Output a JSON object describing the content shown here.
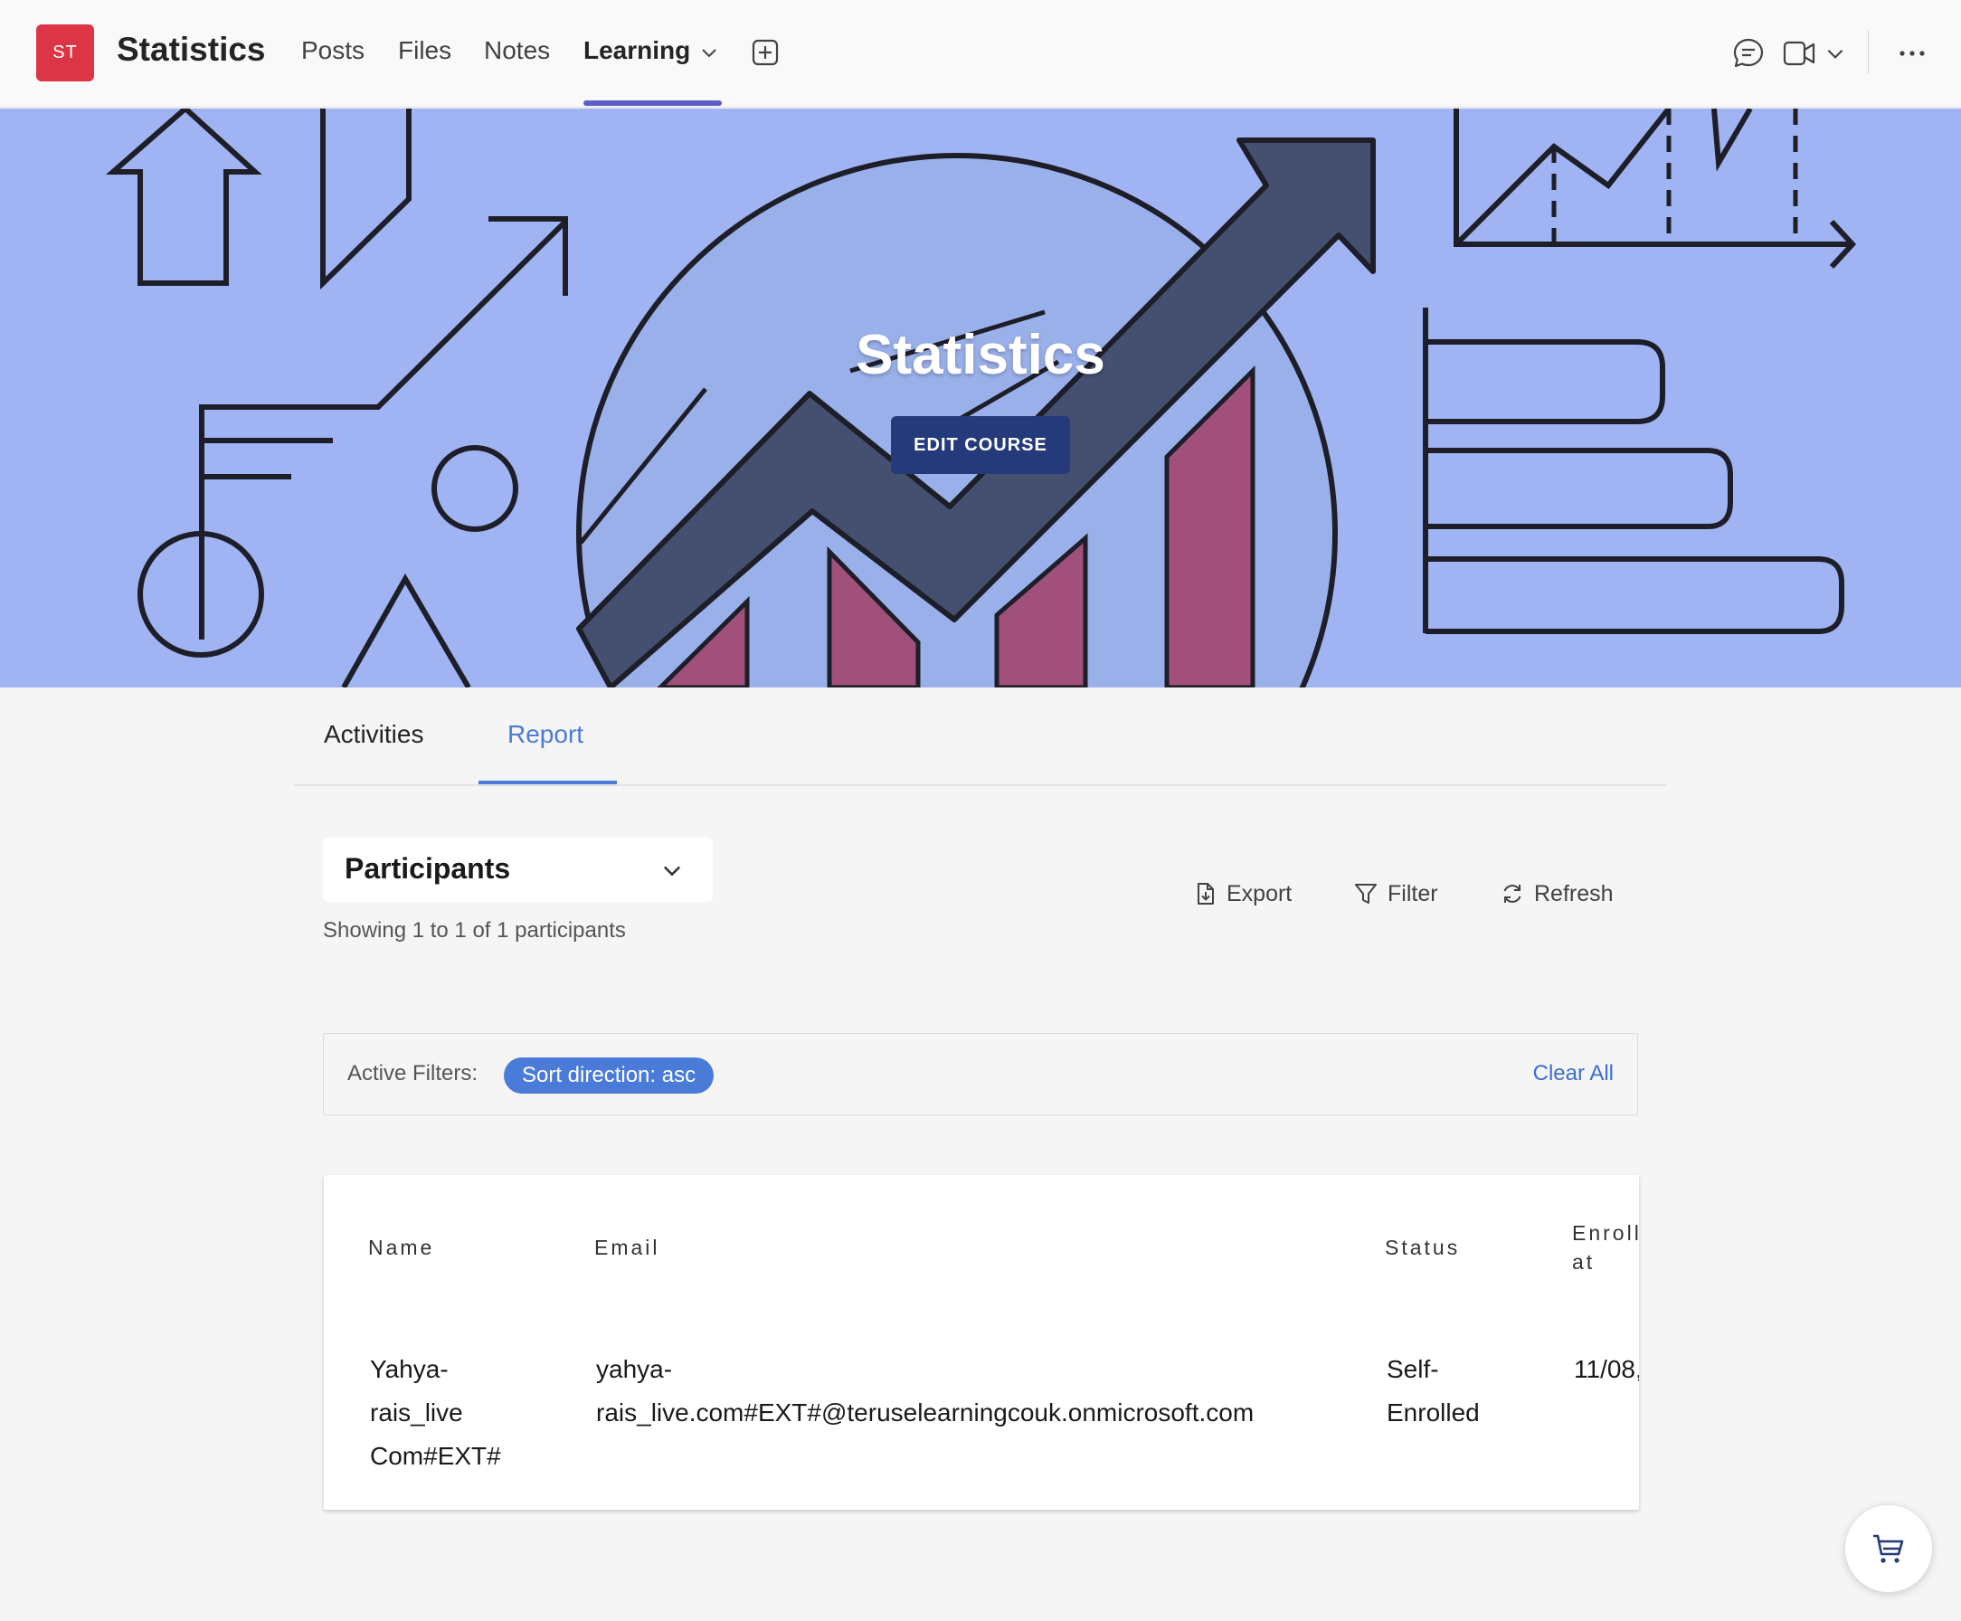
{
  "team": {
    "avatar_initials": "ST",
    "name": "Statistics"
  },
  "nav": {
    "tabs": [
      {
        "label": "Posts"
      },
      {
        "label": "Files"
      },
      {
        "label": "Notes"
      },
      {
        "label": "Learning"
      }
    ],
    "active_tab": "Learning"
  },
  "icons": {
    "add_tab": "add-square-icon",
    "chat": "chat-bubble-icon",
    "video": "video-camera-icon",
    "more": "more-horizontal-icon",
    "cart": "shopping-cart-icon"
  },
  "banner": {
    "title": "Statistics",
    "edit_button": "EDIT COURSE"
  },
  "subtabs": [
    {
      "label": "Activities"
    },
    {
      "label": "Report"
    }
  ],
  "report": {
    "selected_report": "Participants",
    "showing_text": "Showing 1 to 1 of 1 participants",
    "actions": {
      "export": "Export",
      "filter": "Filter",
      "refresh": "Refresh"
    },
    "active_filters_label": "Active Filters:",
    "filter_chip": "Sort direction: asc",
    "clear_all": "Clear All"
  },
  "table": {
    "headers": {
      "name": "Name",
      "email": "Email",
      "status": "Status",
      "enrolled_line1": "Enroll",
      "enrolled_line2": "at"
    },
    "rows": [
      {
        "name_l1": "Yahya-",
        "name_l2": "rais_live",
        "name_l3": "Com#EXT#",
        "email_l1": "yahya-",
        "email_l2": "rais_live.com#EXT#@teruselearningcouk.onmicrosoft.com",
        "status_l1": "Self-",
        "status_l2": "Enrolled",
        "enrolled": "11/08,"
      }
    ]
  },
  "colors": {
    "team_avatar": "#dc3545",
    "nav_accent": "#5b5fc7",
    "banner_bg": "#a0b4f4",
    "edit_button_bg": "#243a7a",
    "link_blue": "#4a7bd9",
    "chart_bar": "#a0507a",
    "arrow_fill": "#455070"
  }
}
